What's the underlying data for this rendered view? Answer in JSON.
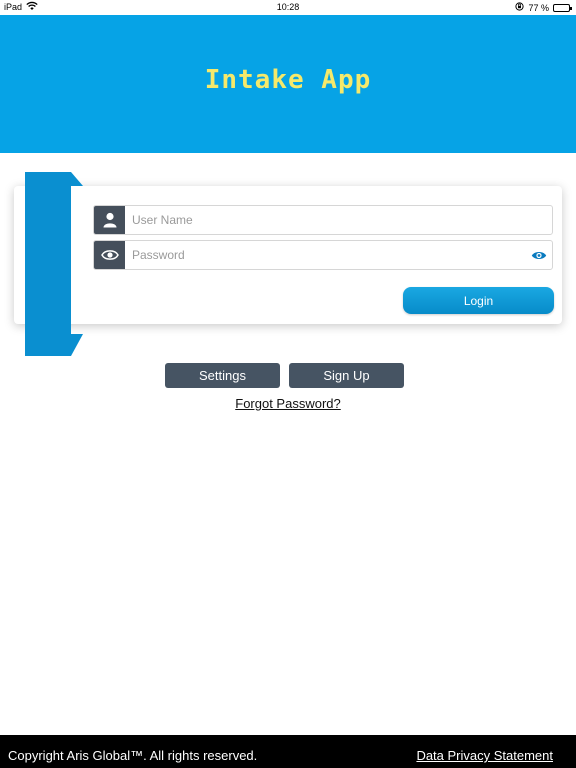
{
  "status_bar": {
    "device": "iPad",
    "time": "10:28",
    "battery": "77 %",
    "battery_level": 0.77
  },
  "header": {
    "title": "Intake App",
    "background_color": "#06a3e6",
    "title_color": "#f5e96b"
  },
  "login_form": {
    "username": {
      "placeholder": "User Name",
      "value": "",
      "icon": "user-icon"
    },
    "password": {
      "placeholder": "Password",
      "value": "",
      "icon": "eye-icon",
      "toggle_icon": "eye-icon"
    },
    "login_label": "Login",
    "accent_color": "#0a8fd0"
  },
  "actions": {
    "settings_label": "Settings",
    "signup_label": "Sign Up",
    "forgot_label": "Forgot Password?"
  },
  "footer": {
    "copyright": "Copyright Aris Global™. All rights reserved.",
    "privacy_label": "Data Privacy Statement"
  }
}
